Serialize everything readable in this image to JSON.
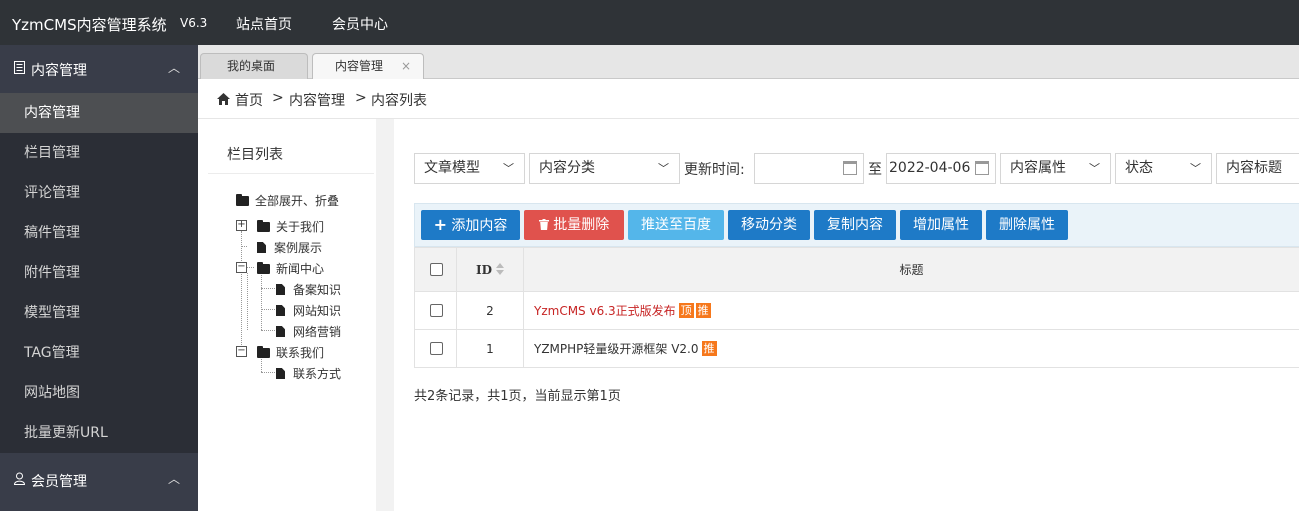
{
  "header": {
    "brand": "YzmCMS内容管理系统",
    "version": "V6.3",
    "nav": [
      "站点首页",
      "会员中心"
    ]
  },
  "sidebar": {
    "groups": [
      {
        "label": "内容管理",
        "icon": "document-icon"
      },
      {
        "label": "会员管理",
        "icon": "user-icon"
      }
    ],
    "items": [
      "内容管理",
      "栏目管理",
      "评论管理",
      "稿件管理",
      "附件管理",
      "模型管理",
      "TAG管理",
      "网站地图",
      "批量更新URL"
    ],
    "active_index": 0
  },
  "tabs": [
    {
      "label": "我的桌面"
    },
    {
      "label": "内容管理",
      "close": "×"
    }
  ],
  "breadcrumb": [
    "首页",
    ">",
    "内容管理",
    ">",
    "内容列表"
  ],
  "tree": {
    "title": "栏目列表",
    "root": "全部展开、折叠",
    "nodes": [
      "关于我们",
      "案例展示",
      "新闻中心",
      "备案知识",
      "网站知识",
      "网络营销",
      "联系我们",
      "联系方式"
    ]
  },
  "filters": {
    "model": "文章模型",
    "category": "内容分类",
    "update_time_label": "更新时间:",
    "date_from": "",
    "to_label": "至",
    "date_to": "2022-04-06",
    "attribute": "内容属性",
    "status": "状态",
    "title_field": "内容标题"
  },
  "buttons": {
    "add": "添加内容",
    "batch_delete": "批量删除",
    "push_baidu": "推送至百度",
    "move": "移动分类",
    "copy": "复制内容",
    "add_attr": "增加属性",
    "del_attr": "删除属性"
  },
  "table": {
    "headers": {
      "id": "ID",
      "title": "标题"
    },
    "rows": [
      {
        "id": "2",
        "title": "YzmCMS v6.3正式版发布",
        "badges": [
          "顶",
          "推"
        ],
        "highlight": true
      },
      {
        "id": "1",
        "title": "YZMPHP轻量级开源框架 V2.0",
        "badges": [
          "推"
        ],
        "highlight": false
      }
    ]
  },
  "pager": "共2条记录，共1页，当前显示第1页",
  "colors": {
    "topbar": "#2f3337",
    "sidebar": "#393d49",
    "primary_button": "#1e7ac7",
    "danger_button": "#e0524d",
    "light_button": "#54b6ea",
    "highlight_title": "#c72424",
    "badge": "#f6781c"
  }
}
